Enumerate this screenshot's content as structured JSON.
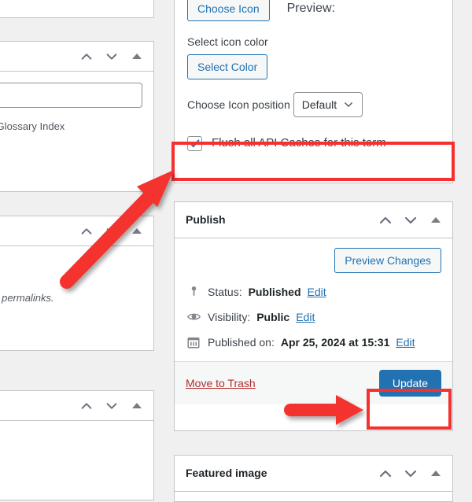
{
  "page": {
    "app": "WordPress Term Editor",
    "background_color": "#f0f0f1",
    "accent_color": "#2271b1",
    "highlight_color": "#f4312f",
    "trash_link_color": "#b32d2e"
  },
  "left_column": {
    "panel_top": {
      "name": "clipped-panel-top"
    },
    "panel_glossary": {
      "input_value": "",
      "help_text": "e on the Glossary Index"
    },
    "panel_permalinks": {
      "help_text": "aste their permalinks."
    },
    "panel_bottom": {
      "name": "clipped-panel-bottom"
    },
    "handle_icons": {
      "move_up": "chevron-up-icon",
      "move_down": "chevron-down-icon",
      "toggle": "triangle-toggle-icon"
    }
  },
  "icon_settings": {
    "icon_input_value": "",
    "choose_icon_label": "Choose Icon",
    "preview_label": "Preview:",
    "select_icon_color_label": "Select icon color",
    "select_color_label": "Select Color",
    "choose_icon_position_label": "Choose Icon position",
    "icon_position_value": "Default",
    "icon_position_caret": "chevron-down-icon",
    "flush_caches_label": "Flush all API Caches for this term",
    "flush_caches_checked": true
  },
  "publish": {
    "title": "Publish",
    "preview_changes_label": "Preview Changes",
    "rows": [
      {
        "icon": "post-status-pin-icon",
        "label": "Status:",
        "value": "Published",
        "edit": "Edit"
      },
      {
        "icon": "visibility-eye-icon",
        "label": "Visibility:",
        "value": "Public",
        "edit": "Edit"
      },
      {
        "icon": "calendar-icon",
        "label": "Published on:",
        "value": "Apr 25, 2024 at 15:31",
        "edit": "Edit"
      }
    ],
    "trash_label": "Move to Trash",
    "update_label": "Update",
    "handle_icons": {
      "move_up": "chevron-up-icon",
      "move_down": "chevron-down-icon",
      "toggle": "triangle-toggle-icon"
    }
  },
  "featured_image": {
    "title": "Featured image",
    "handle_icons": {
      "move_up": "chevron-up-icon",
      "move_down": "chevron-down-icon",
      "toggle": "triangle-toggle-icon"
    }
  },
  "annotations": {
    "highlight_flush_caches": "red-rectangle-highlight",
    "highlight_update_button": "red-rectangle-highlight",
    "arrow_to_flush_caches": "red-diagonal-arrow",
    "arrow_to_update": "red-horizontal-arrow"
  }
}
